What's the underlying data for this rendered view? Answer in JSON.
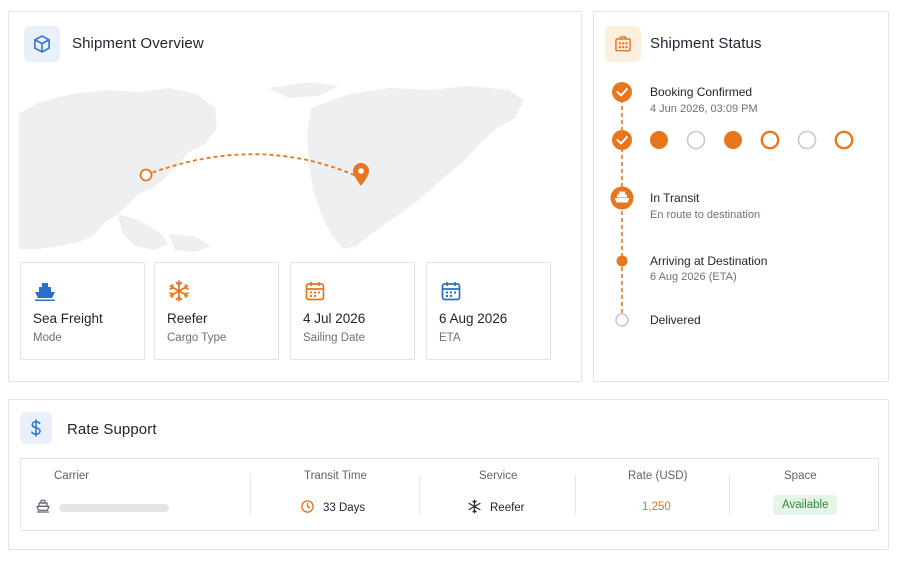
{
  "overview": {
    "title": "Shipment Overview",
    "header_icon": "package-icon",
    "map": {
      "origin_icon": "origin-marker-icon",
      "destination_icon": "destination-pin-icon"
    },
    "cards": [
      {
        "icon": "ship-icon",
        "value": "Sea Freight",
        "label": "Mode"
      },
      {
        "icon": "snowflake-icon",
        "value": "Reefer",
        "label": "Cargo Type"
      },
      {
        "icon": "calendar-icon",
        "value": "4 Jul 2026",
        "label": "Sailing Date"
      },
      {
        "icon": "calendar-icon",
        "value": "6 Aug 2026",
        "label": "ETA"
      }
    ]
  },
  "status": {
    "title": "Shipment Status",
    "header_icon": "building-icon",
    "steps": [
      {
        "title": "Booking Confirmed",
        "sub": "4 Jun 2026, 03:09 PM",
        "state": "complete"
      },
      {
        "title": "In Transit",
        "sub": "En route to destination",
        "state": "active"
      },
      {
        "title": "Arriving at Destination",
        "sub": "6 Aug 2026 (ETA)",
        "state": "upcoming"
      },
      {
        "title": "Delivered",
        "sub": "",
        "state": "pending"
      }
    ],
    "progress_dots": [
      "filled",
      "empty-grey",
      "filled",
      "empty-orange",
      "empty-grey",
      "empty-orange"
    ]
  },
  "rate": {
    "title": "Rate Support",
    "header_icon": "dollar-icon",
    "columns": [
      "Carrier",
      "Transit Time",
      "Service",
      "Rate (USD)",
      "Space"
    ],
    "row": {
      "carrier_icon": "ship-icon",
      "transit_time": "33 Days",
      "service": "Reefer",
      "rate": "1,250",
      "space": "Available"
    }
  },
  "colors": {
    "accent": "#e8761e",
    "blue": "#2a6fc9",
    "success": "#2f8a3e"
  }
}
